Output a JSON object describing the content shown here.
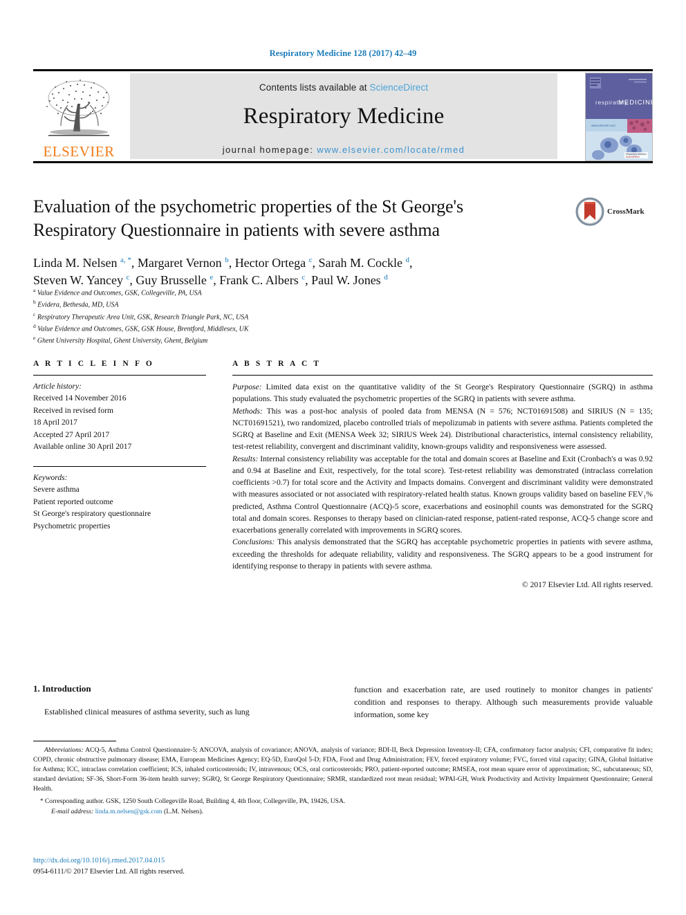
{
  "running_head": "Respiratory Medicine 128 (2017) 42–49",
  "masthead": {
    "publisher": "ELSEVIER",
    "contents_prefix": "Contents lists available at ",
    "contents_link": "ScienceDirect",
    "journal_title": "Respiratory Medicine",
    "homepage_prefix": "journal homepage: ",
    "homepage_url": "www.elsevier.com/locate/rmed",
    "cover_title": "respiratory MEDICINE"
  },
  "crossmark": {
    "label": "CrossMark"
  },
  "article": {
    "title": "Evaluation of the psychometric properties of the St George's Respiratory Questionnaire in patients with severe asthma",
    "authors_line_1": "Linda M. Nelsen <sup>a, *</sup>, Margaret Vernon <sup>b</sup>, Hector Ortega <sup>c</sup>, Sarah M. Cockle <sup>d</sup>,",
    "authors_line_2": "Steven W. Yancey <sup>c</sup>, Guy Brusselle <sup>e</sup>, Frank C. Albers <sup>c</sup>, Paul W. Jones <sup>d</sup>",
    "affiliations": [
      {
        "marker": "a",
        "text": "Value Evidence and Outcomes, GSK, Collegeville, PA, USA"
      },
      {
        "marker": "b",
        "text": "Evidera, Bethesda, MD, USA"
      },
      {
        "marker": "c",
        "text": "Respiratory Therapeutic Area Unit, GSK, Research Triangle Park, NC, USA"
      },
      {
        "marker": "d",
        "text": "Value Evidence and Outcomes, GSK, GSK House, Brentford, Middlesex, UK"
      },
      {
        "marker": "e",
        "text": "Ghent University Hospital, Ghent University, Ghent, Belgium"
      }
    ]
  },
  "article_info": {
    "heading": "A R T I C L E   I N F O",
    "history_label": "Article history:",
    "history": [
      "Received 14 November 2016",
      "Received in revised form",
      "18 April 2017",
      "Accepted 27 April 2017",
      "Available online 30 April 2017"
    ],
    "keywords_label": "Keywords:",
    "keywords": [
      "Severe asthma",
      "Patient reported outcome",
      "St George's respiratory questionnaire",
      "Psychometric properties"
    ]
  },
  "abstract": {
    "heading": "A B S T R A C T",
    "purpose_label": "Purpose:",
    "purpose_text": " Limited data exist on the quantitative validity of the St George's Respiratory Questionnaire (SGRQ) in asthma populations. This study evaluated the psychometric properties of the SGRQ in patients with severe asthma.",
    "methods_label": "Methods:",
    "methods_text": " This was a post-hoc analysis of pooled data from MENSA (N = 576; NCT01691508) and SIRIUS (N = 135; NCT01691521), two randomized, placebo controlled trials of mepolizumab in patients with severe asthma. Patients completed the SGRQ at Baseline and Exit (MENSA Week 32; SIRIUS Week 24). Distributional characteristics, internal consistency reliability, test-retest reliability, convergent and discriminant validity, known-groups validity and responsiveness were assessed.",
    "results_label": "Results:",
    "results_text": " Internal consistency reliability was acceptable for the total and domain scores at Baseline and Exit (Cronbach's α was 0.92 and 0.94 at Baseline and Exit, respectively, for the total score). Test-retest reliability was demonstrated (intraclass correlation coefficients >0.7) for total score and the Activity and Impacts domains. Convergent and discriminant validity were demonstrated with measures associated or not associated with respiratory-related health status. Known groups validity based on baseline FEV₁% predicted, Asthma Control Questionnaire (ACQ)-5 score, exacerbations and eosinophil counts was demonstrated for the SGRQ total and domain scores. Responses to therapy based on clinician-rated response, patient-rated response, ACQ-5 change score and exacerbations generally correlated with improvements in SGRQ scores.",
    "conclusions_label": "Conclusions:",
    "conclusions_text": " This analysis demonstrated that the SGRQ has acceptable psychometric properties in patients with severe asthma, exceeding the thresholds for adequate reliability, validity and responsiveness. The SGRQ appears to be a good instrument for identifying response to therapy in patients with severe asthma.",
    "copyright": "© 2017 Elsevier Ltd. All rights reserved."
  },
  "introduction": {
    "number_and_title": "1. Introduction",
    "left_paragraph": "Established clinical measures of asthma severity, such as lung",
    "right_paragraph": "function and exacerbation rate, are used routinely to monitor changes in patients' condition and responses to therapy. Although such measurements provide valuable information, some key"
  },
  "footnotes": {
    "abbreviations_label": "Abbreviations:",
    "abbreviations_text": " ACQ-5, Asthma Control Questionnaire-5; ANCOVA, analysis of covariance; ANOVA, analysis of variance; BDI-II, Beck Depression Inventory-II; CFA, confirmatory factor analysis; CFI, comparative fit index; COPD, chronic obstructive pulmonary disease; EMA, European Medicines Agency; EQ-5D, EuroQol 5-D; FDA, Food and Drug Administration; FEV, forced expiratory volume; FVC, forced vital capacity; GINA, Global Initiative for Asthma; ICC, intraclass correlation coefficient; ICS, inhaled corticosteroids; IV, intravenous; OCS, oral corticosteroids; PRO, patient-reported outcome; RMSEA, root mean square error of approximation; SC, subcutaneous; SD, standard deviation; SF-36, Short-Form 36-item health survey; SGRQ, St George Respiratory Questionnaire; SRMR, standardized root mean residual; WPAI-GH, Work Productivity and Activity Impairment Questionnaire; General Health.",
    "corresponding_star": "*",
    "corresponding_text": " Corresponding author. GSK, 1250 South Collegeville Road, Building 4, 4th floor, Collegeville, PA, 19426, USA.",
    "email_label": "E-mail address:",
    "email_address": "linda.m.nelsen@gsk.com",
    "email_suffix": " (L.M. Nelsen).",
    "doi_url": "http://dx.doi.org/10.1016/j.rmed.2017.04.015",
    "issn_line": "0954-6111/© 2017 Elsevier Ltd. All rights reserved."
  },
  "colors": {
    "link_blue": "#1a7bb9",
    "sciencedirect_blue": "#4aa3d8",
    "elsevier_orange": "#ef7d1a",
    "band_gray": "#e3e3e3"
  }
}
